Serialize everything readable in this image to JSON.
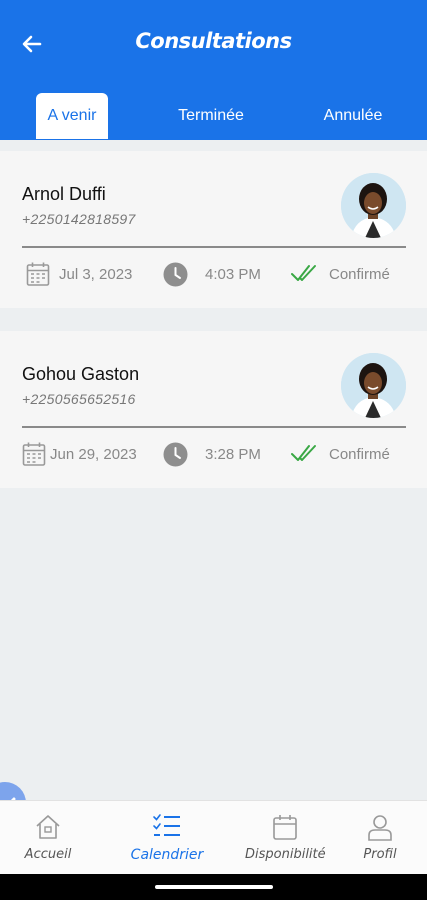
{
  "header": {
    "title": "Consultations"
  },
  "tabs": [
    {
      "label": "A venir",
      "active": true
    },
    {
      "label": "Terminée",
      "active": false
    },
    {
      "label": "Annulée",
      "active": false
    }
  ],
  "appointments": [
    {
      "name": "Arnol Duffi",
      "phone": "+2250142818597",
      "date": "Jul 3, 2023",
      "time": "4:03 PM",
      "status": "Confirmé"
    },
    {
      "name": "Gohou Gaston",
      "phone": "+2250565652516",
      "date": "Jun 29, 2023",
      "time": "3:28 PM",
      "status": "Confirmé"
    }
  ],
  "nav": [
    {
      "label": "Accueil",
      "icon": "home-icon"
    },
    {
      "label": "Calendrier",
      "icon": "checklist-icon",
      "active": true
    },
    {
      "label": "Disponibilité",
      "icon": "calendar-icon"
    },
    {
      "label": "Profil",
      "icon": "user-icon"
    }
  ],
  "colors": {
    "primary": "#1a73e8",
    "success": "#3aa845",
    "background": "#eceff1"
  }
}
